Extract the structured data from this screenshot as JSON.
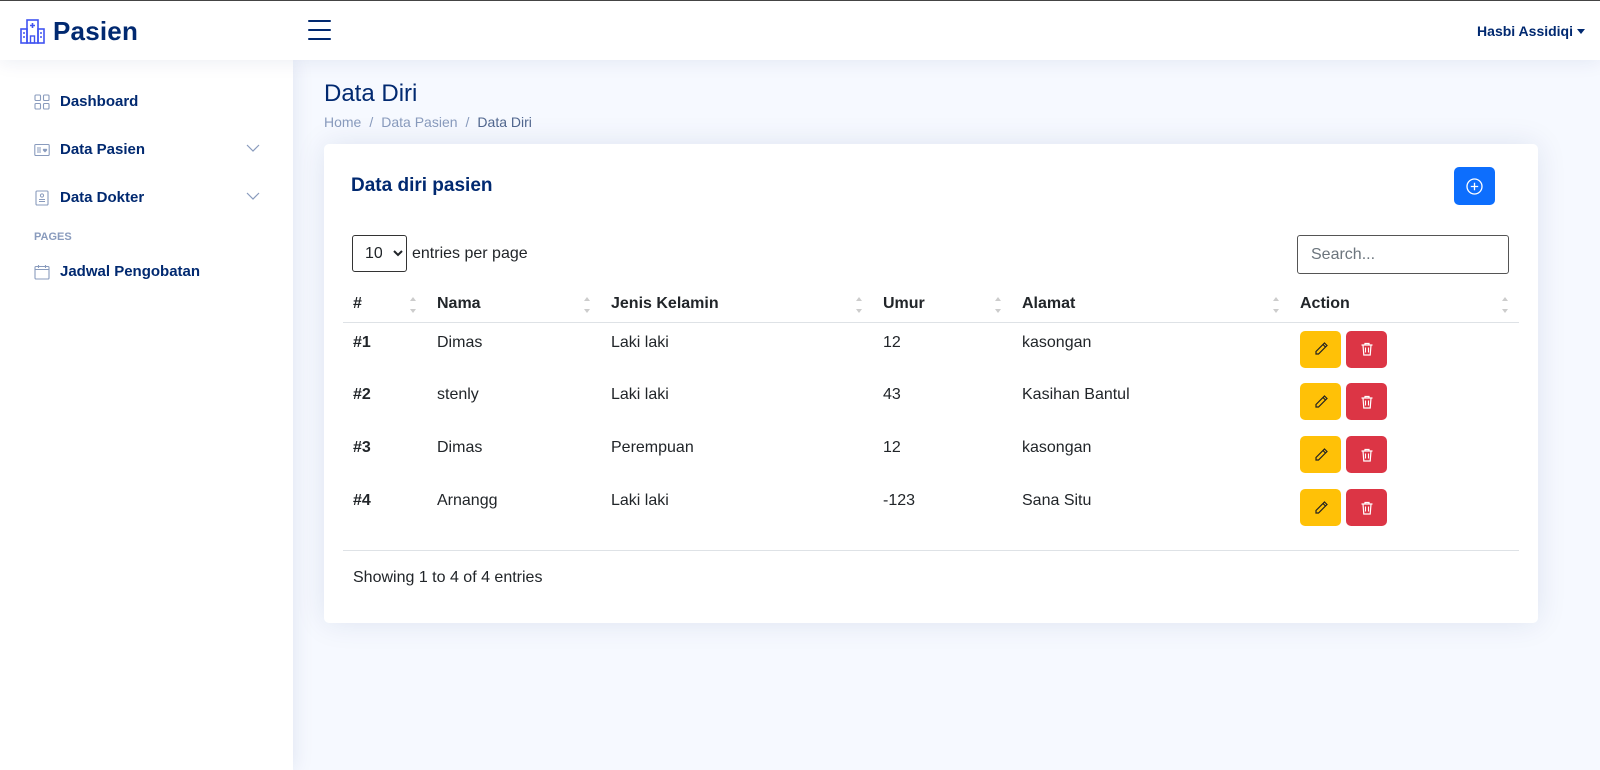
{
  "header": {
    "brand": "Pasien",
    "user_name": "Hasbi Assidiqi"
  },
  "sidebar": {
    "items": [
      {
        "label": "Dashboard",
        "icon": "grid-icon"
      },
      {
        "label": "Data Pasien",
        "icon": "card-heart-icon"
      },
      {
        "label": "Data Dokter",
        "icon": "person-list-icon"
      }
    ],
    "heading": "PAGES",
    "pages": [
      {
        "label": "Jadwal Pengobatan",
        "icon": "calendar-icon"
      }
    ]
  },
  "page": {
    "title": "Data Diri",
    "breadcrumb": [
      "Home",
      "Data Pasien",
      "Data Diri"
    ]
  },
  "card": {
    "title": "Data diri pasien",
    "entries_value": "10",
    "entries_label": "entries per page",
    "search_placeholder": "Search...",
    "columns": [
      "#",
      "Nama",
      "Jenis Kelamin",
      "Umur",
      "Alamat",
      "Action"
    ],
    "rows": [
      {
        "no": "#1",
        "nama": "Dimas",
        "jk": "Laki laki",
        "umur": "12",
        "alamat": "kasongan"
      },
      {
        "no": "#2",
        "nama": "stenly",
        "jk": "Laki laki",
        "umur": "43",
        "alamat": "Kasihan Bantul"
      },
      {
        "no": "#3",
        "nama": "Dimas",
        "jk": "Perempuan",
        "umur": "12",
        "alamat": "kasongan"
      },
      {
        "no": "#4",
        "nama": "Arnangg",
        "jk": "Laki laki",
        "umur": "-123",
        "alamat": "Sana Situ"
      }
    ],
    "info": "Showing 1 to 4 of 4 entries"
  },
  "colors": {
    "primary": "#012970",
    "add_button": "#0d6efd",
    "edit_button": "#ffc107",
    "delete_button": "#dc3545"
  }
}
